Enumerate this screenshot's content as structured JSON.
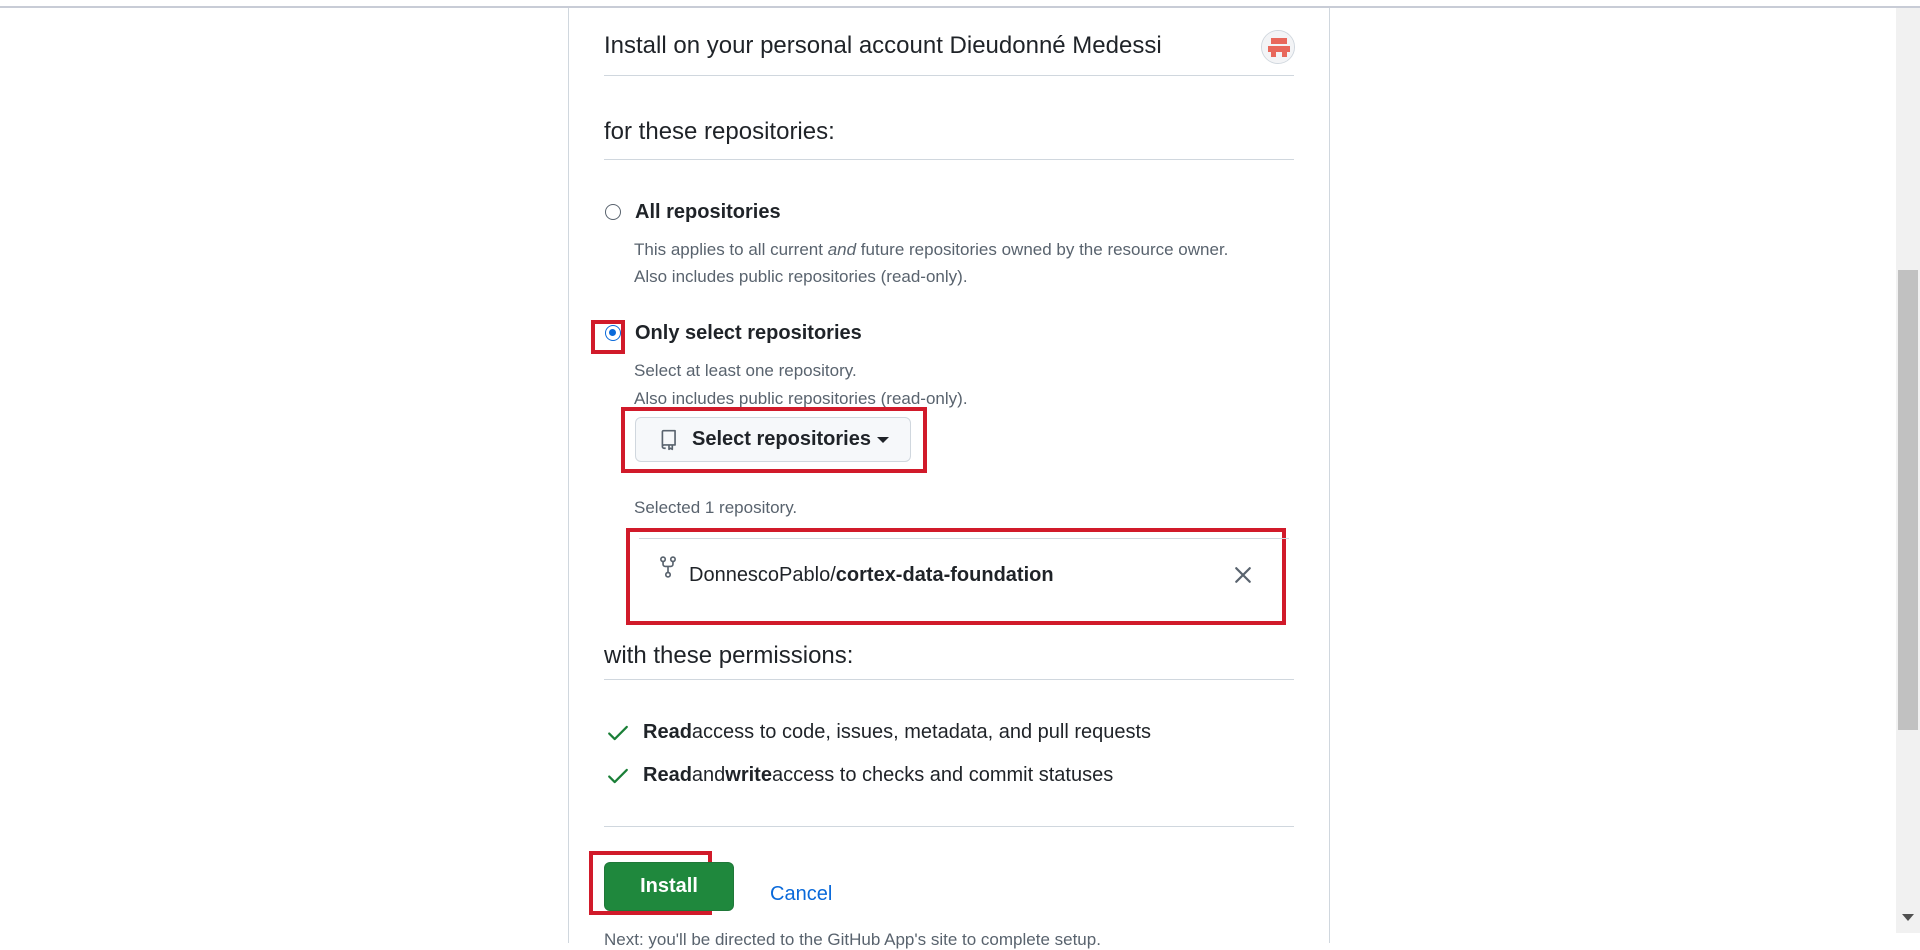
{
  "owner": {
    "title": "Install on your personal account Dieudonné Medessi",
    "avatar_icon": "identicon-avatar"
  },
  "repositories_section": {
    "title": "for these repositories:",
    "options": [
      {
        "label": "All repositories",
        "selected": false,
        "desc_line1_pre": "This applies to all current ",
        "desc_line1_em": "and",
        "desc_line1_post": " future repositories owned by the resource owner.",
        "desc_line2": "Also includes public repositories (read-only)."
      },
      {
        "label": "Only select repositories",
        "selected": true,
        "desc_line1": "Select at least one repository.",
        "desc_line2": "Also includes public repositories (read-only)."
      }
    ],
    "select_button_label": "Select repositories",
    "selected_count_text": "Selected 1 repository.",
    "selected_repos": [
      {
        "owner": "DonnescoPablo/",
        "name": "cortex-data-foundation",
        "icon": "repo-forked-icon"
      }
    ]
  },
  "permissions_section": {
    "title": "with these permissions:",
    "items": [
      {
        "bold1": "Read",
        "text1": " access to code, issues, metadata, and pull requests"
      },
      {
        "bold1": "Read",
        "text1": " and ",
        "bold2": "write",
        "text2": " access to checks and commit statuses"
      }
    ]
  },
  "actions": {
    "install_label": "Install",
    "cancel_label": "Cancel",
    "footer_text": "Next: you'll be directed to the GitHub App's site to complete setup."
  },
  "colors": {
    "primary_button": "#1f883d",
    "link": "#0969da",
    "highlight": "#d11a2a",
    "check": "#1a7f37"
  }
}
